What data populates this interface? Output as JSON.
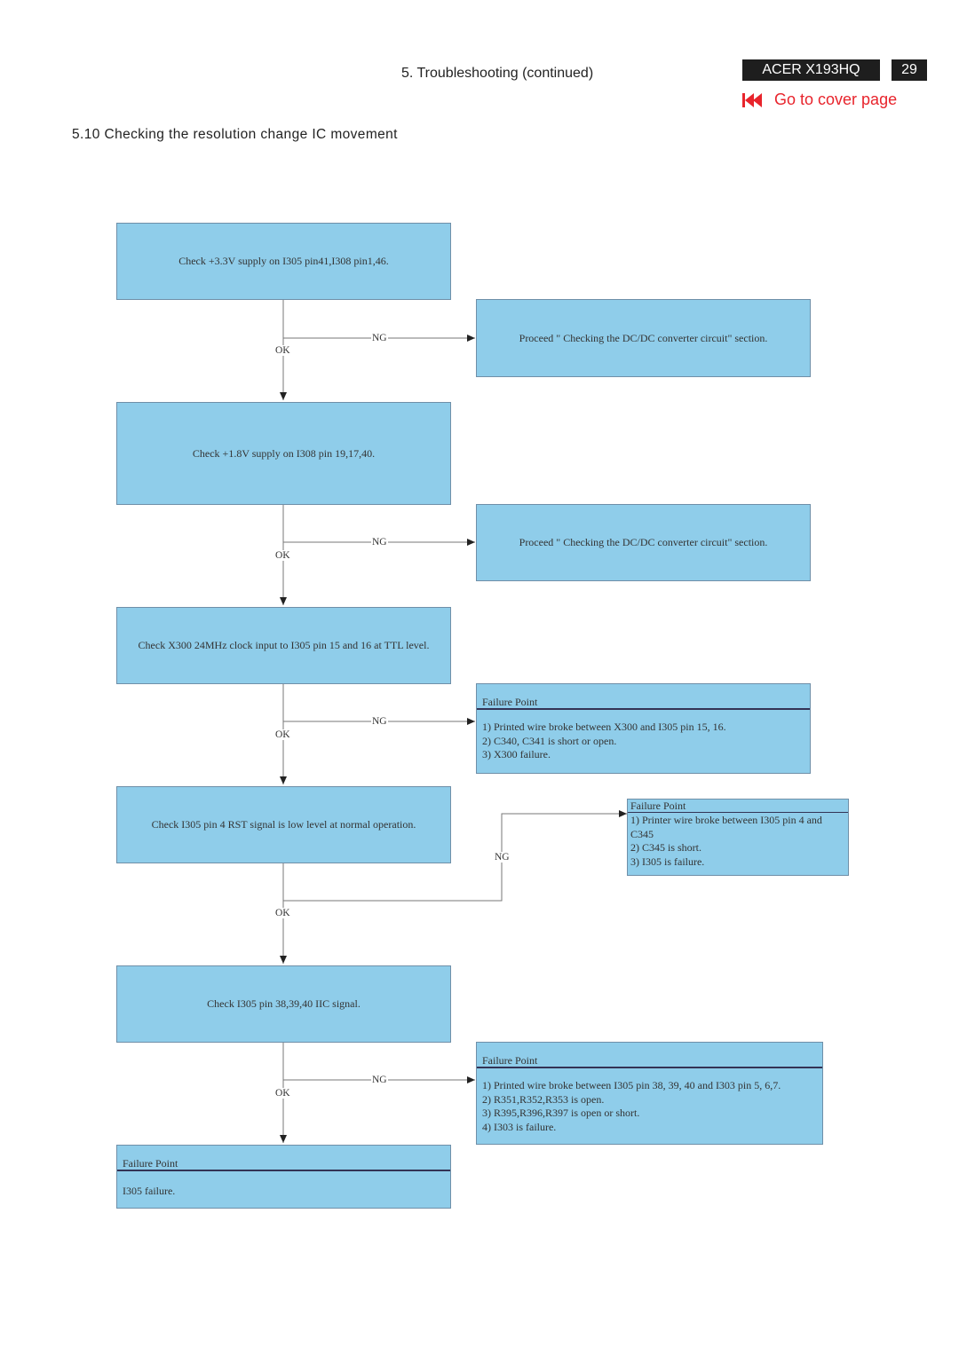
{
  "header": {
    "section_heading": "5. Troubleshooting (continued)",
    "model": "ACER X193HQ",
    "page_number": "29",
    "cover_link": {
      "icon": "skip-to-start-icon",
      "label": "Go to cover page",
      "color": "#e8242c"
    }
  },
  "section_title": "5.10 Checking the resolution change IC movement",
  "colors": {
    "box_fill": "#8fcdea",
    "box_border": "#6f8fa8",
    "connector": "#777777"
  },
  "flow": {
    "ok_label": "OK",
    "ng_label": "NG",
    "steps": [
      {
        "id": "step1",
        "text": "Check +3.3V supply on I305 pin41,I308 pin1,46."
      },
      {
        "id": "step2",
        "text": "Check +1.8V supply on I308 pin 19,17,40."
      },
      {
        "id": "step3",
        "text": "Check X300 24MHz clock input to I305 pin 15 and 16 at TTL level."
      },
      {
        "id": "step4",
        "text": "Check I305 pin 4 RST signal is low level at normal operation."
      },
      {
        "id": "step5",
        "text": "Check I305 pin 38,39,40 IIC signal."
      }
    ],
    "ng_results": [
      {
        "id": "ng1",
        "text": "Proceed \" Checking the DC/DC converter circuit\" section."
      },
      {
        "id": "ng2",
        "text": "Proceed \" Checking the DC/DC converter circuit\" section."
      },
      {
        "id": "ng3",
        "title": "Failure Point",
        "items": [
          "1) Printed wire broke between X300 and I305 pin 15, 16.",
          "2) C340, C341 is short or open.",
          "3) X300 failure."
        ]
      },
      {
        "id": "ng4",
        "title": "Failure Point",
        "items": [
          "1) Printer wire broke between I305 pin 4 and",
          "C345",
          "2) C345 is short.",
          "3) I305 is failure."
        ]
      },
      {
        "id": "ng5",
        "title": "Failure Point",
        "items": [
          "1) Printed wire broke between I305 pin 38, 39, 40 and I303 pin 5, 6,7.",
          "2) R351,R352,R353 is open.",
          "3) R395,R396,R397 is open or short.",
          "4) I303 is failure."
        ]
      }
    ],
    "final": {
      "title": "Failure Point",
      "text": "I305 failure."
    }
  }
}
